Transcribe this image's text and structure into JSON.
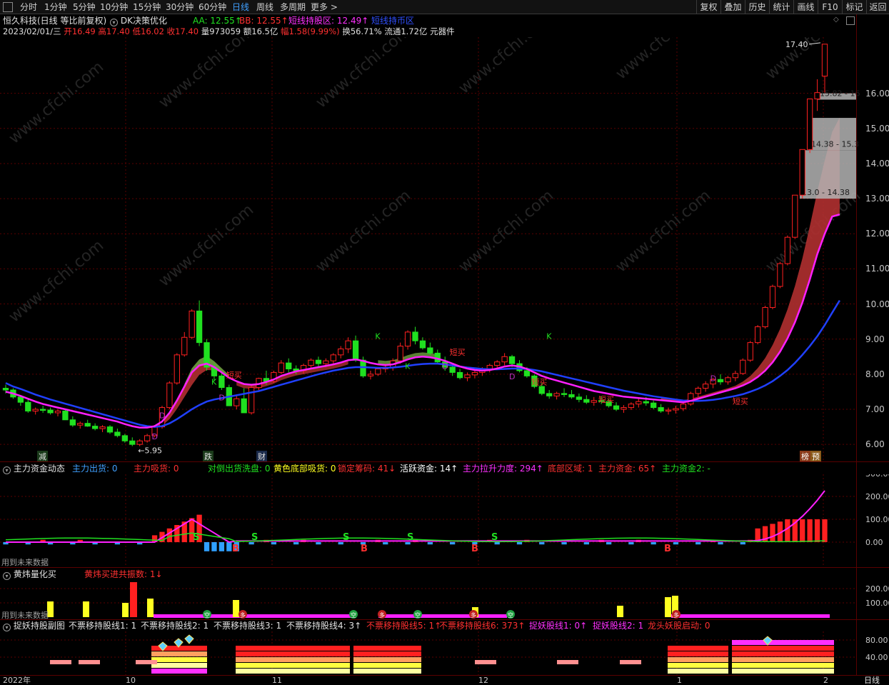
{
  "top_bar": {
    "periods": [
      "分时",
      "1分钟",
      "5分钟",
      "10分钟",
      "15分钟",
      "30分钟",
      "60分钟",
      "日线",
      "周线",
      "多周期",
      "更多"
    ],
    "active_period": "日线",
    "right_buttons": [
      "复权",
      "叠加",
      "历史",
      "统计",
      "画线",
      "F10",
      "标记",
      "返回"
    ]
  },
  "header": {
    "stock_name": "恒久科技(日线 等比前复权)",
    "indicator_name": "DK决策优化",
    "aa": "AA: 12.55↑",
    "bb": "BB: 12.55↑",
    "short_hold": "短线持股区: 12.49↑",
    "short_hold_coin": "短线持币区"
  },
  "quote_line": {
    "date": "2023/02/01/三",
    "open_label": "开",
    "open": "16.49",
    "high_label": "高",
    "high": "17.40",
    "low_label": "低",
    "low": "16.02",
    "close_label": "收",
    "close": "17.40",
    "volume_label": "量",
    "volume": "973059",
    "amount_label": "额",
    "amount": "16.5亿",
    "change_label": "幅",
    "change": "1.58(9.99%)",
    "turnover_label": "换",
    "turnover": "56.71%",
    "float_label": "流通",
    "float": "1.72亿",
    "sector": "元器件"
  },
  "main_chart": {
    "y_axis": [
      "16.00",
      "15.00",
      "14.00",
      "13.00",
      "12.00",
      "11.00",
      "10.00",
      "9.00",
      "8.00",
      "7.00",
      "6.00"
    ],
    "high_marker": "17.40",
    "low_marker": "5.95",
    "zones": [
      "15.82 - 16",
      "14.38 - 15.3",
      "13.0 - 14.38"
    ],
    "event_tags": [
      "减",
      "跌",
      "财",
      "榜",
      "预"
    ],
    "signal_labels": [
      "D",
      "D",
      "K",
      "D",
      "短买",
      "K",
      "K",
      "D",
      "短买",
      "D",
      "短买",
      "K",
      "短买",
      "D",
      "短买"
    ]
  },
  "chart_data": {
    "type": "candlestick",
    "y_range": [
      5.8,
      17.6
    ],
    "y_ticks": [
      6,
      7,
      8,
      9,
      10,
      11,
      12,
      13,
      14,
      15,
      16
    ],
    "ohlc": [
      [
        7.6,
        7.7,
        7.45,
        7.55
      ],
      [
        7.55,
        7.6,
        7.3,
        7.35
      ],
      [
        7.35,
        7.4,
        7.1,
        7.2
      ],
      [
        7.2,
        7.3,
        6.9,
        6.95
      ],
      [
        6.95,
        7.05,
        6.85,
        7.0
      ],
      [
        7.0,
        7.1,
        6.9,
        6.98
      ],
      [
        6.98,
        7.05,
        6.85,
        6.9
      ],
      [
        6.9,
        7.0,
        6.8,
        6.95
      ],
      [
        6.95,
        7.0,
        6.75,
        6.7
      ],
      [
        6.7,
        6.8,
        6.5,
        6.55
      ],
      [
        6.55,
        6.65,
        6.45,
        6.6
      ],
      [
        6.6,
        6.7,
        6.5,
        6.52
      ],
      [
        6.52,
        6.6,
        6.4,
        6.45
      ],
      [
        6.45,
        6.55,
        6.35,
        6.5
      ],
      [
        6.5,
        6.55,
        6.3,
        6.35
      ],
      [
        6.35,
        6.45,
        6.2,
        6.25
      ],
      [
        6.25,
        6.3,
        6.05,
        6.1
      ],
      [
        6.1,
        6.2,
        5.95,
        6.0
      ],
      [
        6.0,
        6.15,
        5.95,
        6.1
      ],
      [
        6.1,
        6.3,
        6.05,
        6.25
      ],
      [
        6.25,
        6.55,
        6.2,
        6.5
      ],
      [
        6.5,
        7.1,
        6.45,
        7.05
      ],
      [
        7.05,
        7.8,
        7.0,
        7.75
      ],
      [
        7.75,
        8.6,
        7.7,
        8.55
      ],
      [
        8.55,
        9.2,
        8.5,
        9.05
      ],
      [
        9.05,
        9.85,
        9.0,
        9.8
      ],
      [
        9.8,
        10.1,
        8.8,
        8.9
      ],
      [
        8.9,
        9.0,
        8.1,
        8.2
      ],
      [
        8.2,
        8.3,
        7.8,
        7.95
      ],
      [
        7.95,
        8.05,
        7.55,
        7.62
      ],
      [
        7.62,
        7.7,
        7.2,
        7.1
      ],
      [
        7.1,
        7.4,
        7.0,
        7.3
      ],
      [
        7.3,
        7.6,
        7.2,
        6.9
      ],
      [
        6.9,
        7.7,
        6.85,
        7.62
      ],
      [
        7.62,
        7.9,
        7.55,
        7.88
      ],
      [
        7.88,
        8.1,
        7.7,
        7.8
      ],
      [
        7.8,
        8.1,
        7.75,
        8.05
      ],
      [
        8.05,
        8.4,
        8.0,
        8.32
      ],
      [
        8.32,
        8.45,
        8.05,
        8.15
      ],
      [
        8.15,
        8.25,
        8.0,
        8.1
      ],
      [
        8.1,
        8.3,
        8.02,
        8.25
      ],
      [
        8.25,
        8.45,
        8.15,
        8.4
      ],
      [
        8.4,
        8.5,
        8.2,
        8.3
      ],
      [
        8.3,
        8.45,
        8.2,
        8.38
      ],
      [
        8.38,
        8.6,
        8.3,
        8.55
      ],
      [
        8.55,
        8.8,
        8.45,
        8.72
      ],
      [
        8.72,
        9.05,
        8.6,
        8.95
      ],
      [
        8.95,
        9.1,
        8.35,
        8.4
      ],
      [
        8.4,
        8.5,
        7.9,
        7.95
      ],
      [
        7.95,
        8.1,
        7.85,
        8.0
      ],
      [
        8.0,
        8.2,
        7.95,
        8.15
      ],
      [
        8.15,
        8.3,
        8.05,
        8.2
      ],
      [
        8.2,
        8.45,
        8.1,
        8.38
      ],
      [
        8.38,
        8.9,
        8.3,
        8.8
      ],
      [
        8.8,
        9.25,
        8.7,
        9.2
      ],
      [
        9.2,
        9.35,
        8.85,
        8.95
      ],
      [
        8.95,
        9.05,
        8.7,
        8.75
      ],
      [
        8.75,
        8.9,
        8.55,
        8.6
      ],
      [
        8.6,
        8.7,
        8.3,
        8.35
      ],
      [
        8.35,
        8.5,
        8.1,
        8.2
      ],
      [
        8.2,
        8.3,
        7.95,
        8.05
      ],
      [
        8.05,
        8.15,
        7.85,
        7.9
      ],
      [
        7.9,
        8.05,
        7.8,
        7.98
      ],
      [
        7.98,
        8.1,
        7.88,
        8.05
      ],
      [
        8.05,
        8.2,
        7.95,
        8.12
      ],
      [
        8.12,
        8.3,
        8.05,
        8.25
      ],
      [
        8.25,
        8.4,
        8.15,
        8.35
      ],
      [
        8.35,
        8.6,
        8.25,
        8.5
      ],
      [
        8.5,
        8.55,
        8.2,
        8.3
      ],
      [
        8.3,
        8.4,
        8.05,
        8.1
      ],
      [
        8.1,
        8.2,
        7.9,
        7.95
      ],
      [
        7.95,
        8.0,
        7.6,
        7.65
      ],
      [
        7.65,
        7.75,
        7.4,
        7.45
      ],
      [
        7.45,
        7.55,
        7.3,
        7.38
      ],
      [
        7.38,
        7.5,
        7.28,
        7.45
      ],
      [
        7.45,
        7.6,
        7.35,
        7.42
      ],
      [
        7.42,
        7.55,
        7.3,
        7.35
      ],
      [
        7.35,
        7.45,
        7.2,
        7.28
      ],
      [
        7.28,
        7.4,
        7.15,
        7.2
      ],
      [
        7.2,
        7.35,
        7.1,
        7.25
      ],
      [
        7.25,
        7.38,
        7.15,
        7.22
      ],
      [
        7.22,
        7.3,
        7.05,
        7.1
      ],
      [
        7.1,
        7.2,
        6.95,
        7.0
      ],
      [
        7.0,
        7.12,
        6.9,
        7.05
      ],
      [
        7.05,
        7.2,
        6.98,
        7.15
      ],
      [
        7.15,
        7.3,
        7.05,
        7.22
      ],
      [
        7.22,
        7.35,
        7.1,
        7.18
      ],
      [
        7.18,
        7.25,
        7.0,
        7.05
      ],
      [
        7.05,
        7.15,
        6.9,
        6.95
      ],
      [
        6.95,
        7.05,
        6.85,
        6.98
      ],
      [
        6.98,
        7.1,
        6.88,
        7.02
      ],
      [
        7.02,
        7.2,
        6.95,
        7.15
      ],
      [
        7.15,
        7.5,
        7.1,
        7.45
      ],
      [
        7.45,
        7.65,
        7.35,
        7.6
      ],
      [
        7.6,
        7.8,
        7.5,
        7.72
      ],
      [
        7.72,
        7.9,
        7.6,
        7.85
      ],
      [
        7.85,
        8.0,
        7.7,
        7.78
      ],
      [
        7.78,
        7.95,
        7.7,
        7.9
      ],
      [
        7.9,
        8.1,
        7.8,
        8.02
      ],
      [
        8.02,
        8.45,
        7.98,
        8.4
      ],
      [
        8.4,
        8.95,
        8.35,
        8.9
      ],
      [
        8.9,
        9.4,
        8.85,
        9.35
      ],
      [
        9.35,
        9.95,
        9.3,
        9.9
      ],
      [
        9.9,
        10.55,
        9.85,
        10.5
      ],
      [
        10.5,
        11.2,
        10.45,
        11.15
      ],
      [
        11.15,
        11.95,
        11.1,
        11.9
      ],
      [
        11.9,
        13.1,
        11.85,
        13.1
      ],
      [
        13.1,
        14.4,
        13.0,
        14.4
      ],
      [
        14.4,
        15.84,
        14.3,
        15.84
      ],
      [
        15.84,
        16.4,
        15.5,
        16.02
      ],
      [
        16.49,
        17.4,
        16.02,
        17.4
      ]
    ],
    "ma_pink": [
      7.5,
      7.45,
      7.38,
      7.3,
      7.22,
      7.15,
      7.1,
      7.05,
      7.0,
      6.95,
      6.9,
      6.85,
      6.8,
      6.75,
      6.7,
      6.65,
      6.58,
      6.52,
      6.48,
      6.48,
      6.52,
      6.65,
      6.9,
      7.25,
      7.65,
      8.05,
      8.25,
      8.3,
      8.2,
      8.05,
      7.9,
      7.8,
      7.72,
      7.7,
      7.72,
      7.78,
      7.85,
      7.95,
      8.02,
      8.08,
      8.12,
      8.16,
      8.2,
      8.24,
      8.28,
      8.33,
      8.4,
      8.42,
      8.38,
      8.32,
      8.28,
      8.26,
      8.28,
      8.34,
      8.42,
      8.48,
      8.5,
      8.48,
      8.44,
      8.38,
      8.3,
      8.22,
      8.16,
      8.12,
      8.1,
      8.12,
      8.16,
      8.22,
      8.25,
      8.22,
      8.15,
      8.05,
      7.95,
      7.88,
      7.82,
      7.76,
      7.7,
      7.64,
      7.58,
      7.52,
      7.48,
      7.44,
      7.4,
      7.36,
      7.34,
      7.32,
      7.3,
      7.28,
      7.26,
      7.24,
      7.22,
      7.2,
      7.24,
      7.3,
      7.36,
      7.42,
      7.48,
      7.54,
      7.6,
      7.68,
      7.78,
      7.92,
      8.1,
      8.34,
      8.64,
      9.02,
      9.48,
      10.04,
      10.7,
      11.42,
      12.0,
      12.49,
      12.55
    ],
    "ma_blue": [
      7.75,
      7.65,
      7.58,
      7.5,
      7.42,
      7.35,
      7.28,
      7.22,
      7.16,
      7.1,
      7.04,
      6.98,
      6.92,
      6.86,
      6.8,
      6.74,
      6.68,
      6.62,
      6.56,
      6.52,
      6.5,
      6.52,
      6.6,
      6.72,
      6.86,
      7.0,
      7.12,
      7.22,
      7.28,
      7.32,
      7.36,
      7.4,
      7.44,
      7.48,
      7.52,
      7.58,
      7.64,
      7.7,
      7.76,
      7.82,
      7.88,
      7.94,
      8.0,
      8.05,
      8.1,
      8.14,
      8.18,
      8.2,
      8.2,
      8.19,
      8.18,
      8.18,
      8.19,
      8.21,
      8.24,
      8.27,
      8.29,
      8.3,
      8.3,
      8.28,
      8.25,
      8.22,
      8.19,
      8.17,
      8.15,
      8.14,
      8.14,
      8.15,
      8.16,
      8.16,
      8.15,
      8.12,
      8.08,
      8.03,
      7.98,
      7.93,
      7.88,
      7.83,
      7.78,
      7.73,
      7.68,
      7.63,
      7.58,
      7.53,
      7.49,
      7.45,
      7.41,
      7.37,
      7.34,
      7.31,
      7.28,
      7.25,
      7.24,
      7.24,
      7.25,
      7.27,
      7.3,
      7.34,
      7.38,
      7.43,
      7.5,
      7.58,
      7.68,
      7.8,
      7.95,
      8.12,
      8.32,
      8.55,
      8.8,
      9.08,
      9.4,
      9.75,
      10.1
    ]
  },
  "panel1": {
    "title": "主力资金动态",
    "fields": [
      "主力出货: 0",
      "主力吸货: 0",
      "对倒出货洗盘: 0",
      "黄色底部吸货: 0",
      "锁定筹码: 41↓",
      "活跃资金: 14↑",
      "主力拉升力度: 294↑",
      "底部区域: 1",
      "主力资金: 65↑",
      "主力资金2: -"
    ],
    "y_axis": [
      "300.00",
      "200.00",
      "100.00",
      "0.00"
    ],
    "note": "用到未来数据",
    "marks": [
      "S",
      "S",
      "S",
      "S",
      "S",
      "B",
      "B",
      "B",
      "B"
    ]
  },
  "panel2": {
    "title": "黄炜量化买",
    "fields": [
      "黄炜买进共振数: 1↓"
    ],
    "y_axis": [
      "200.00",
      "100.00"
    ],
    "note": "用到未来数据",
    "badges": [
      "空",
      "多",
      "空",
      "多",
      "空",
      "多",
      "空",
      "多"
    ]
  },
  "panel3": {
    "title": "捉妖持股副图",
    "fields": [
      "不票移持股线1: 1",
      "不票移持股线2: 1",
      "不票移持股线3: 1",
      "不票移持股线4: 3↑",
      "不票移持股线5: 1↑",
      "不票移持股线6: 373↑",
      "捉妖股线1: 0↑",
      "捉妖股线2: 1",
      "龙头妖股启动: 0"
    ],
    "y_axis": [
      "80.00",
      "40.00"
    ]
  },
  "date_axis": {
    "labels": [
      "2022年",
      "10",
      "11",
      "12",
      "1",
      "2"
    ],
    "mode": "日线"
  },
  "watermark": "www.cfchi.com",
  "colors": {
    "up": "#ff2020",
    "down": "#20e020",
    "pink_line": "#ff20ff",
    "blue_line": "#2040ff",
    "red_band": "#b03030",
    "green_band": "#70a040",
    "zone_gray": "#b4b4b4",
    "yellow": "#ffff20",
    "magenta": "#ff20ff",
    "grid_red": "#5a0000"
  }
}
